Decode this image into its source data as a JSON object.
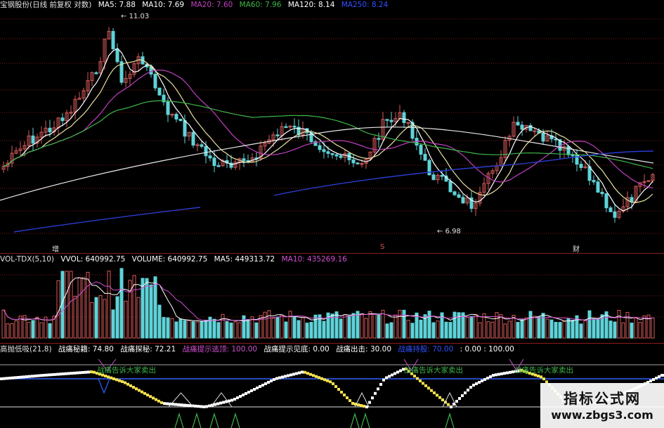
{
  "colors": {
    "up": "#d65a5a",
    "down": "#5fd3d8",
    "ma5": "#ffffff",
    "ma10": "#e8e0a0",
    "ma20": "#c040c0",
    "ma60": "#3db64a",
    "ma120": "#e8e8e8",
    "ma250": "#2a3ccf",
    "grid": "#7a1a1a",
    "yellow": "#f4e04d",
    "green": "#3db64a",
    "blue": "#3060ff",
    "magenta": "#d050d0"
  },
  "price_panel": {
    "title": "宝钢股份(日线 前复权 对数)",
    "ma": [
      {
        "label": "MA5: 7.88",
        "color": "#ffffff"
      },
      {
        "label": "MA10: 7.69",
        "color": "#ffffff"
      },
      {
        "label": "MA20: 7.60",
        "color": "#c040c0"
      },
      {
        "label": "MA60: 7.96",
        "color": "#3db64a"
      },
      {
        "label": "MA120: 8.14",
        "color": "#ffffff"
      },
      {
        "label": "MA250: 8.24",
        "color": "#3050ff"
      }
    ],
    "high_label": "11.03",
    "low_label": "6.98",
    "markers": [
      "增",
      "S",
      "财"
    ]
  },
  "volume_panel": {
    "title": "VOL-TDX(5,10)",
    "values": [
      {
        "label": "VVOL: 640992.75",
        "color": "#ffffff"
      },
      {
        "label": "VOLUME: 640992.75",
        "color": "#ffffff"
      },
      {
        "label": "MA5: 449313.72",
        "color": "#ffffff"
      },
      {
        "label": "MA10: 435269.16",
        "color": "#d050d0"
      }
    ]
  },
  "indicator_panel": {
    "title": "高抛低吸(21,8)",
    "values": [
      {
        "label": "战痛秘籍: 74.80",
        "color": "#ffffff"
      },
      {
        "label": "战痛探秘: 72.21",
        "color": "#ffffff"
      },
      {
        "label": "战痛提示逃顶: 100.00",
        "color": "#d050d0"
      },
      {
        "label": "战痛提示见底: 0.00",
        "color": "#ffffff"
      },
      {
        "label": "战痛出击: 30.00",
        "color": "#ffffff"
      },
      {
        "label": "战痛持股: 70.00",
        "color": "#3050ff"
      },
      {
        "label": ": 0.00 : 100.00",
        "color": "#ffffff"
      }
    ],
    "sell_notes": [
      "战痛告诉大家卖出",
      "战痛告诉大家卖出",
      "战痛告诉大家卖出"
    ]
  },
  "watermark": {
    "title": "指标公式网",
    "url": "www.zbgs3.com"
  }
}
